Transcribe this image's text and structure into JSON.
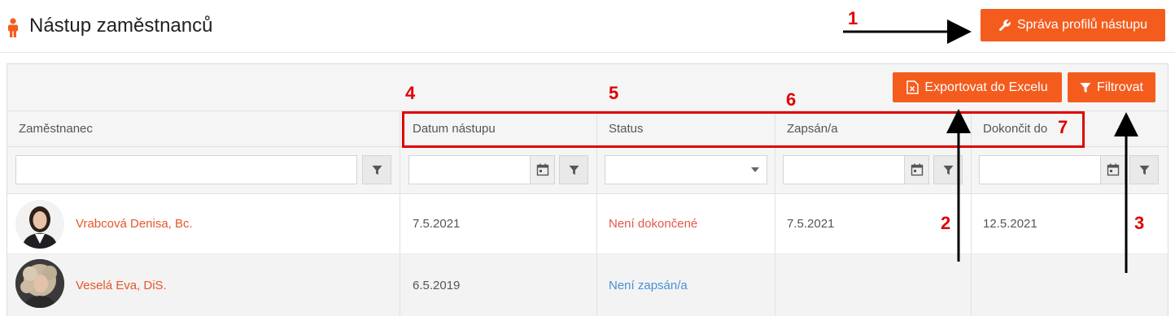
{
  "header": {
    "title": "Nástup zaměstnanců",
    "profiles_button": "Správa profilů nástupu"
  },
  "toolbar": {
    "export_button": "Exportovat do Excelu",
    "filter_button": "Filtrovat"
  },
  "columns": [
    "Zaměstnanec",
    "Datum nástupu",
    "Status",
    "Zapsán/a",
    "Dokončit do"
  ],
  "rows": [
    {
      "name": "Vrabcová Denisa, Bc.",
      "start_date": "7.5.2021",
      "status": "Není dokončené",
      "enrolled": "7.5.2021",
      "due": "12.5.2021"
    },
    {
      "name": "Veselá Eva, DiS.",
      "start_date": "6.5.2019",
      "status": "Není zapsán/a",
      "enrolled": "",
      "due": ""
    }
  ],
  "annotations": [
    "1",
    "2",
    "3",
    "4",
    "5",
    "6",
    "7"
  ],
  "colors": {
    "accent": "#f45c1e",
    "annotation": "#e00000",
    "status_red": "#e5564a",
    "status_blue": "#4a90d9"
  },
  "icons": [
    "person-icon",
    "wrench-icon",
    "excel-icon",
    "filter-icon",
    "calendar-icon",
    "chevron-down-icon"
  ]
}
